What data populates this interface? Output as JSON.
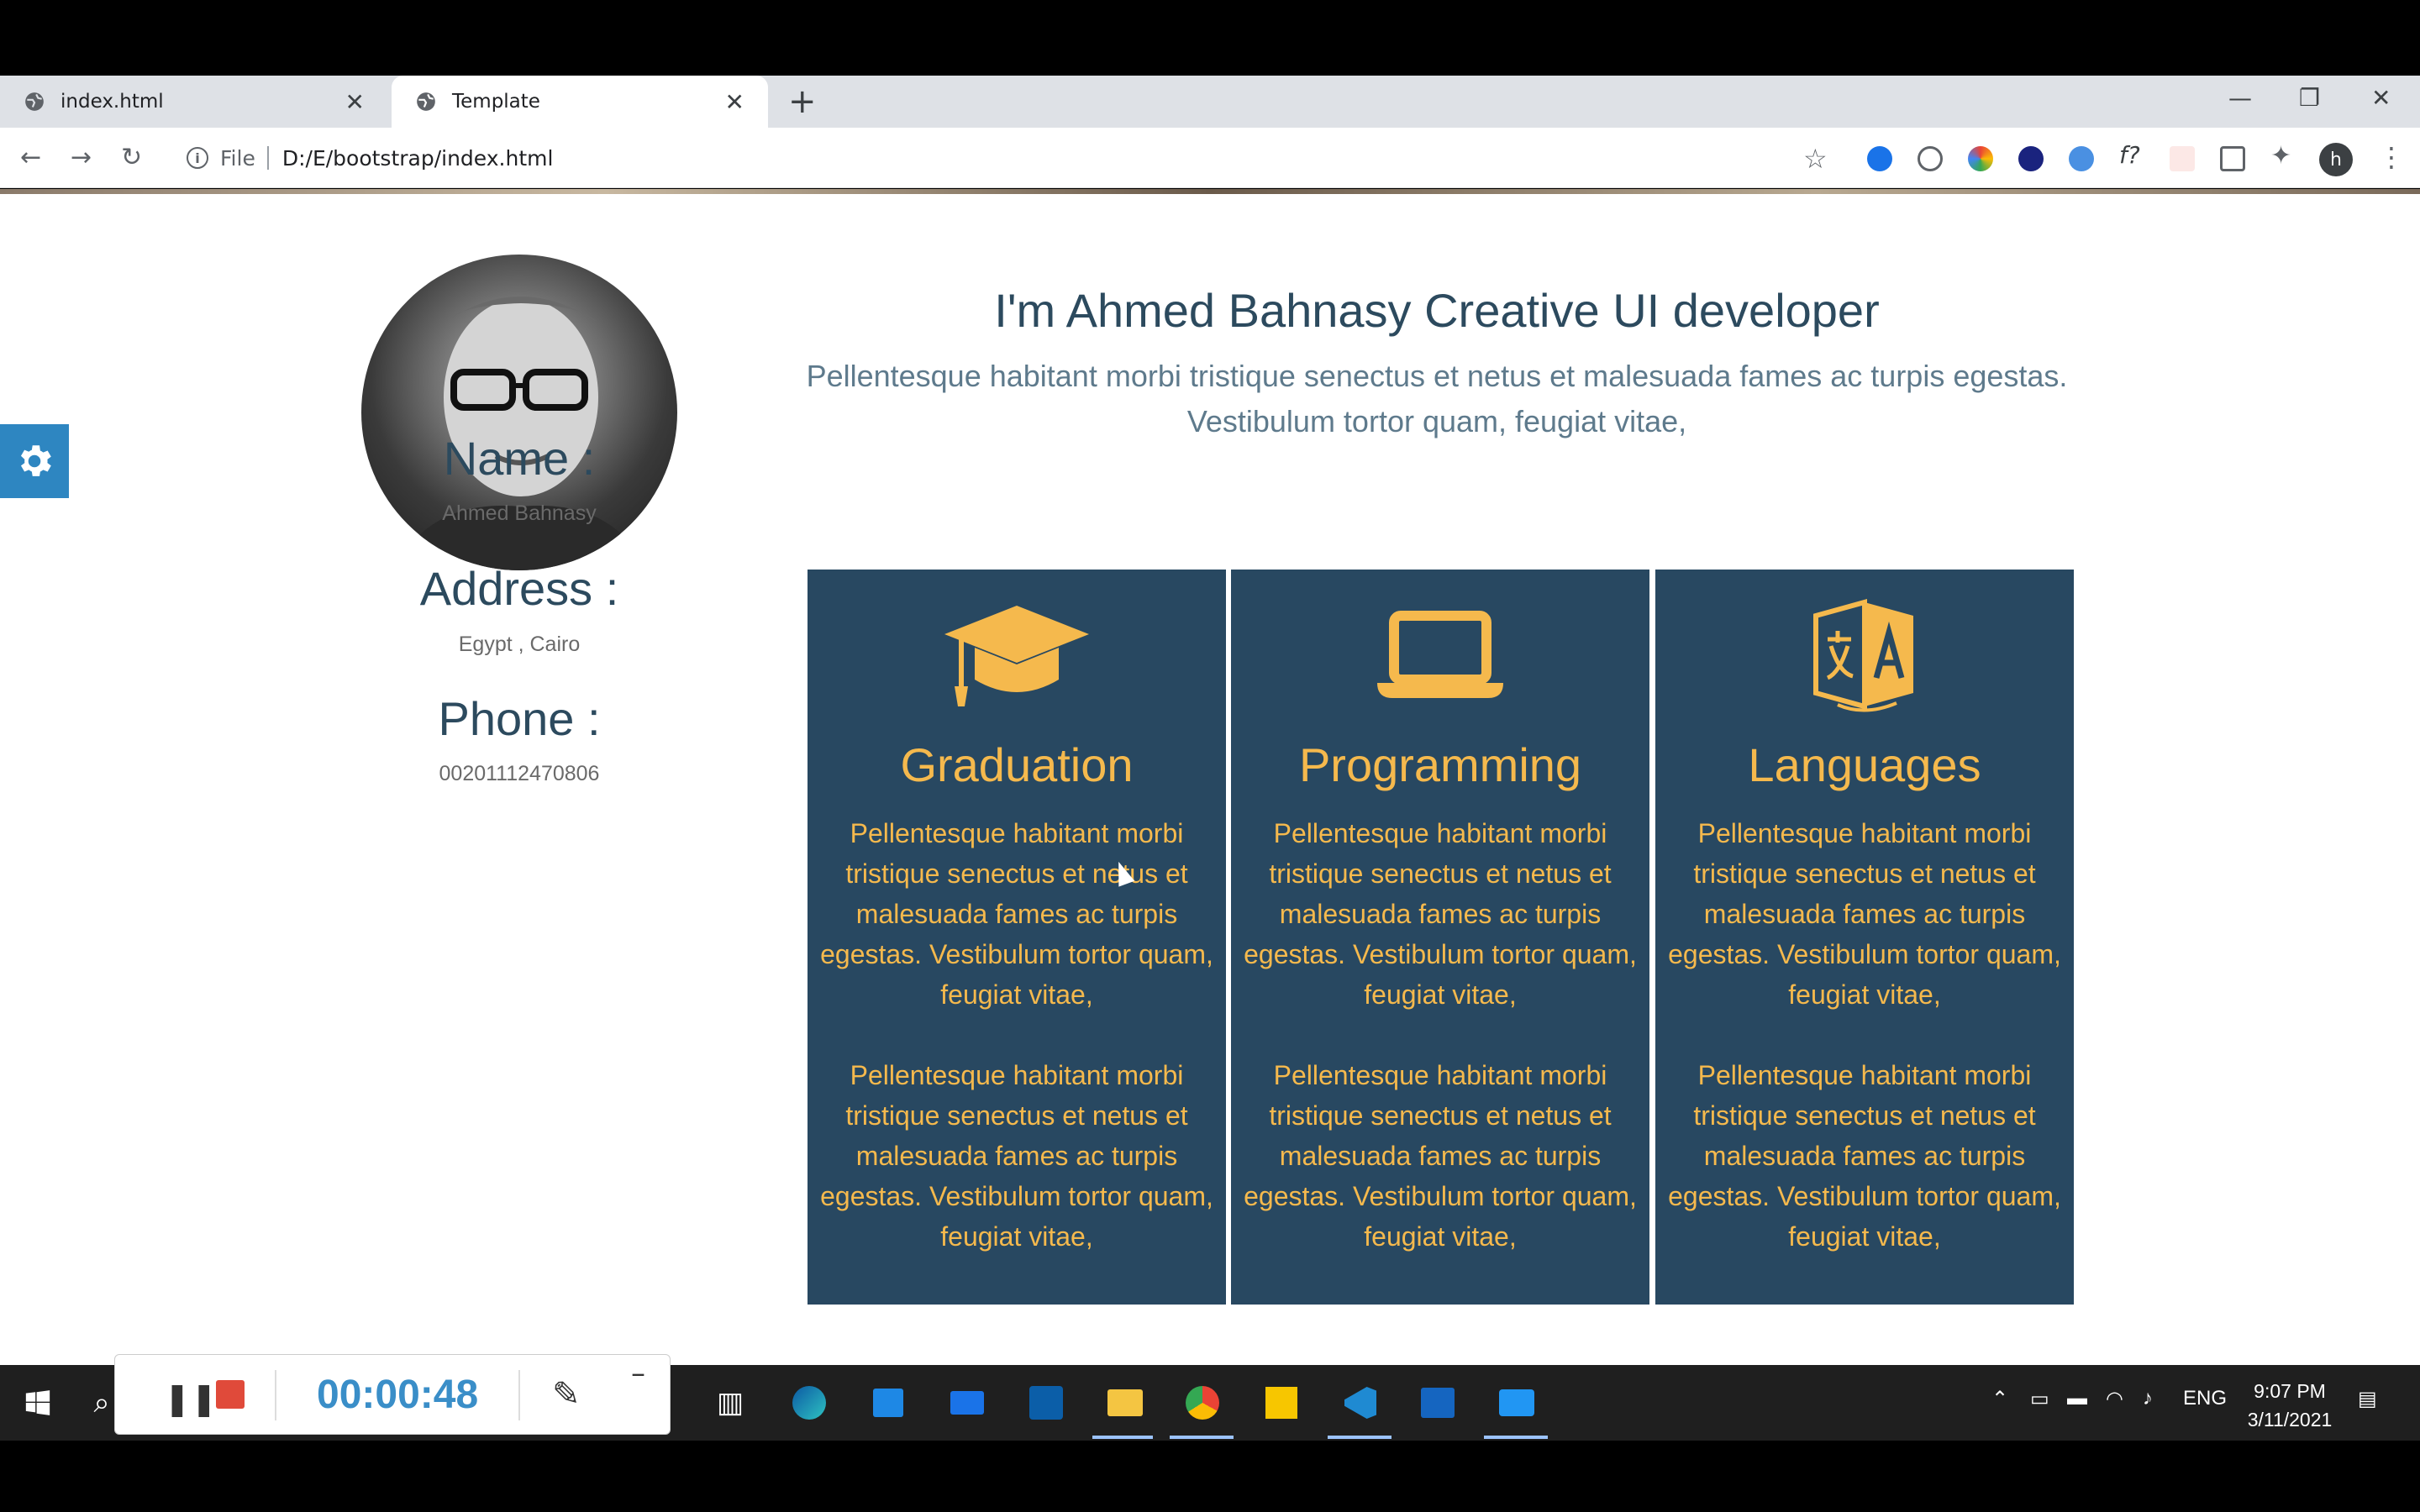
{
  "browser": {
    "tabs": [
      {
        "title": "index.html",
        "active": false
      },
      {
        "title": "Template",
        "active": true
      }
    ],
    "address": {
      "scheme_label": "File",
      "url": "D:/E/bootstrap/index.html"
    },
    "profile_initial": "h"
  },
  "profile": {
    "name_label": "Name :",
    "name_value": "Ahmed Bahnasy",
    "address_label": "Address :",
    "address_value": "Egypt , Cairo",
    "phone_label": "Phone :",
    "phone_value": "00201112470806"
  },
  "hero": {
    "headline": "I'm Ahmed Bahnasy Creative UI developer",
    "subline": "Pellentesque habitant morbi tristique senectus et netus et malesuada fames ac turpis egestas. Vestibulum tortor quam, feugiat vitae,"
  },
  "cards": [
    {
      "icon": "graduation-cap-icon",
      "title": "Graduation",
      "paragraphs": [
        "Pellentesque habitant morbi tristique senectus et netus et malesuada fames ac turpis egestas. Vestibulum tortor quam, feugiat vitae,",
        "Pellentesque habitant morbi tristique senectus et netus et malesuada fames ac turpis egestas. Vestibulum tortor quam, feugiat vitae,"
      ]
    },
    {
      "icon": "laptop-icon",
      "title": "Programming",
      "paragraphs": [
        "Pellentesque habitant morbi tristique senectus et netus et malesuada fames ac turpis egestas. Vestibulum tortor quam, feugiat vitae,",
        "Pellentesque habitant morbi tristique senectus et netus et malesuada fames ac turpis egestas. Vestibulum tortor quam, feugiat vitae,"
      ]
    },
    {
      "icon": "language-icon",
      "title": "Languages",
      "paragraphs": [
        "Pellentesque habitant morbi tristique senectus et netus et malesuada fames ac turpis egestas. Vestibulum tortor quam, feugiat vitae,",
        "Pellentesque habitant morbi tristique senectus et netus et malesuada fames ac turpis egestas. Vestibulum tortor quam, feugiat vitae,"
      ]
    }
  ],
  "recorder": {
    "elapsed": "00:00:48"
  },
  "taskbar": {
    "language": "ENG",
    "time": "9:07 PM",
    "date": "3/11/2021"
  },
  "colors": {
    "card_bg": "#284861",
    "card_accent": "#f5b94d",
    "heading": "#2c4a5e",
    "settings_accent": "#2e86c1"
  }
}
